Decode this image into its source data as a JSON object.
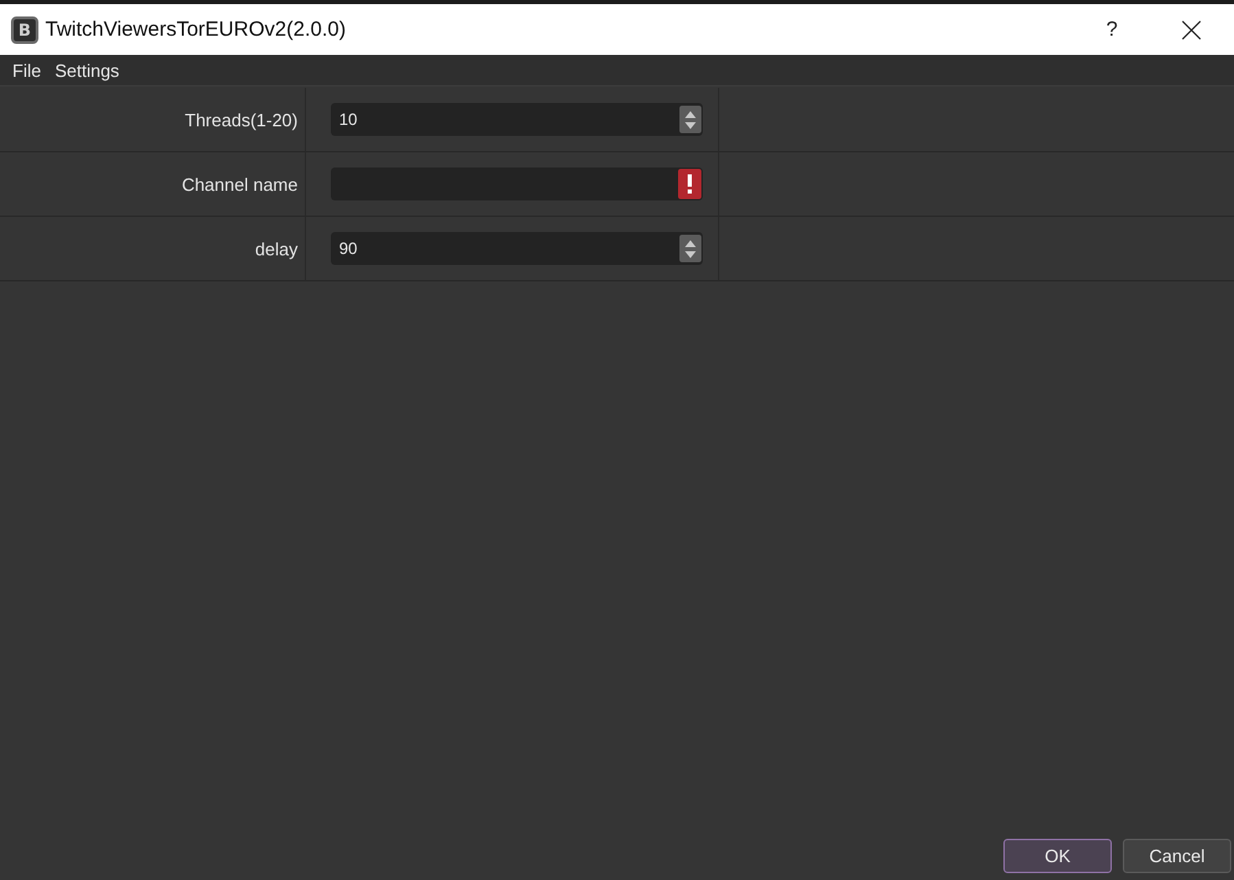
{
  "window": {
    "logo_text": "B",
    "title": "TwitchViewersTorEUROv2(2.0.0)",
    "help_button": "?"
  },
  "menu": [
    "File",
    "Settings"
  ],
  "form": {
    "rows": [
      {
        "label": "Threads(1-20)",
        "kind": "spinbox",
        "value": "10",
        "invalid": false
      },
      {
        "label": "Channel name",
        "kind": "text",
        "invalid": true
      },
      {
        "label": "delay",
        "kind": "spinbox",
        "value": "90",
        "invalid": false
      }
    ]
  },
  "buttons": [
    {
      "label": "OK",
      "default": true
    },
    {
      "label": "Cancel",
      "default": false
    }
  ]
}
